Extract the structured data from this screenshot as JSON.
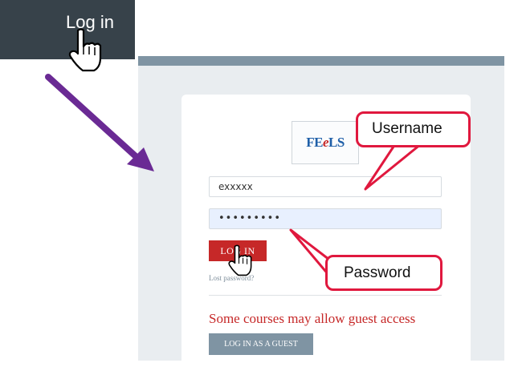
{
  "topbar": {
    "login_label": "Log in"
  },
  "login": {
    "logo_text_a": "FE",
    "logo_text_b": "e",
    "logo_text_c": "LS",
    "username_value": "exxxxx",
    "password_value": "•••••••••",
    "login_button": "LOG IN",
    "lost_password": "Lost password?",
    "guest_note": "Some courses may allow guest access",
    "guest_button": "LOG IN AS A GUEST"
  },
  "callouts": {
    "username": "Username",
    "password": "Password"
  },
  "colors": {
    "accent_red": "#c62828",
    "callout_border": "#e0183e",
    "arrow": "#6a2a94",
    "topbar": "#37424a"
  },
  "icons": [
    "hand-pointer-icon",
    "arrow-icon"
  ]
}
